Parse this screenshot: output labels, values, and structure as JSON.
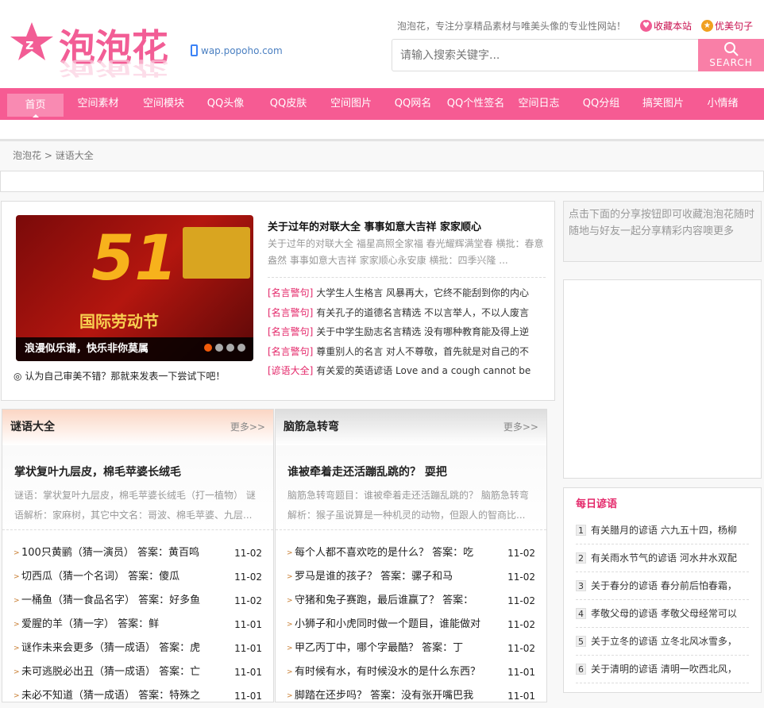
{
  "header": {
    "logo_text": "泡泡花",
    "wap": "wap.popoho.com",
    "slogan": "泡泡花，专注分享精品素材与唯美头像的专业性网站！",
    "bookmark": "收藏本站",
    "sentences": "优美句子",
    "search_placeholder": "请输入搜索关键字...",
    "search_label": "SEARCH"
  },
  "nav": [
    "首页",
    "空间素材",
    "空间模块",
    "QQ头像",
    "QQ皮肤",
    "空间图片",
    "QQ网名",
    "QQ个性签名",
    "空间日志",
    "QQ分组",
    "搞笑图片",
    "小情绪"
  ],
  "breadcrumb": {
    "home": "泡泡花",
    "sep": ">",
    "current": "谜语大全"
  },
  "slider": {
    "caption": "浪漫似乐谱，快乐非你莫属",
    "image_text": "51 国际劳动节",
    "note": "认为自己审美不错？那就来发表一下尝试下吧！"
  },
  "headline": {
    "title": "关于过年的对联大全 事事如意大吉祥 家家顺心",
    "desc": "关于过年的对联大全 福星高照全家福 春光耀辉满堂春 横批：春意盎然 事事如意大吉祥 家家顺心永安康 横批：四季兴隆 ...",
    "items": [
      {
        "tag": "[名言警句]",
        "text": "大学生人生格言 风暴再大，它终不能刮到你的内心"
      },
      {
        "tag": "[名言警句]",
        "text": "有关孔子的道德名言精选 不以言举人，不以人废言"
      },
      {
        "tag": "[名言警句]",
        "text": "关于中学生励志名言精选 没有哪种教育能及得上逆"
      },
      {
        "tag": "[名言警句]",
        "text": "尊重别人的名言 对人不尊敬，首先就是对自己的不"
      },
      {
        "tag": "[谚语大全]",
        "text": "有关爱的英语谚语 Love and a cough cannot be hi"
      }
    ]
  },
  "side": {
    "share_text": "点击下面的分享按钮即可收藏泡泡花随时随地与好友一起分享精彩内容噢更多",
    "daily_title": "每日谚语",
    "daily": [
      "有关腊月的谚语 六九五十四，杨柳",
      "有关雨水节气的谚语 河水井水双配",
      "关于春分的谚语 春分前后怕春霜，",
      "孝敬父母的谚语 孝敬父母经常可以",
      "关于立冬的谚语 立冬北风冰雪多，",
      "关于清明的谚语 清明一吹西北风，"
    ]
  },
  "riddles": {
    "title": "谜语大全",
    "more": "更多>>",
    "feat_title": "掌状复叶九层皮，棉毛苹婆长绒毛",
    "feat_desc": "谜语：掌状复叶九层皮，棉毛苹婆长绒毛（打一植物） 谜语解析：家麻树，其它中文名：哥波、棉毛苹婆、九层...",
    "items": [
      {
        "t": "100只黄鹂（猜一演员） 答案：黄百鸣",
        "d": "11-02"
      },
      {
        "t": "切西瓜（猜一个名词） 答案：傻瓜",
        "d": "11-02"
      },
      {
        "t": "一桶鱼（猜一食品名字） 答案：好多鱼",
        "d": "11-02"
      },
      {
        "t": "爱腥的羊（猜一字） 答案：鲜",
        "d": "11-01"
      },
      {
        "t": "谜作未来会更多（猜一成语） 答案：虎",
        "d": "11-01"
      },
      {
        "t": "未可逃脱必出丑（猜一成语） 答案：亡",
        "d": "11-01"
      },
      {
        "t": "未必不知道（猜一成语） 答案：特殊之",
        "d": "11-01"
      }
    ]
  },
  "brain": {
    "title": "脑筋急转弯",
    "more": "更多>>",
    "feat_title": "谁被牵着走还活蹦乱跳的？ 耍把",
    "feat_desc": "脑筋急转弯题目：谁被牵着走还活蹦乱跳的？ 脑筋急转弯解析：猴子虽说算是一种机灵的动物，但跟人的智商比...",
    "items": [
      {
        "t": "每个人都不喜欢吃的是什么？ 答案：吃",
        "d": "11-02"
      },
      {
        "t": "罗马是谁的孩子？ 答案：骡子和马",
        "d": "11-02"
      },
      {
        "t": "守猪和兔子赛跑，最后谁赢了？ 答案：",
        "d": "11-02"
      },
      {
        "t": "小狮子和小虎同时做一个题目，谁能做对",
        "d": "11-02"
      },
      {
        "t": "甲乙丙丁中，哪个字最酷？ 答案：丁",
        "d": "11-02"
      },
      {
        "t": "有时候有水，有时候没水的是什么东西？",
        "d": "11-01"
      },
      {
        "t": "脚踏在还步吗？ 答案：没有张开嘴巴我",
        "d": "11-01"
      }
    ]
  }
}
